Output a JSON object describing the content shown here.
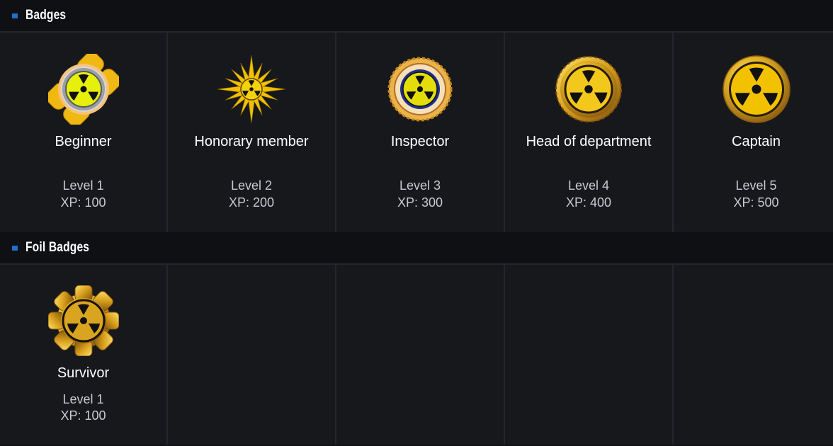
{
  "sections": {
    "badges": {
      "title": "Badges",
      "items": [
        {
          "name": "Beginner",
          "level": "Level 1",
          "xp": "XP: 100",
          "icon": "radiation-badge-cross-icon"
        },
        {
          "name": "Honorary member",
          "level": "Level 2",
          "xp": "XP: 200",
          "icon": "radiation-badge-star-icon"
        },
        {
          "name": "Inspector",
          "level": "Level 3",
          "xp": "XP: 300",
          "icon": "radiation-badge-seal-icon"
        },
        {
          "name": "Head of department",
          "level": "Level 4",
          "xp": "XP: 400",
          "icon": "radiation-badge-sun-icon"
        },
        {
          "name": "Captain",
          "level": "Level 5",
          "xp": "XP: 500",
          "icon": "radiation-badge-coin-icon"
        }
      ]
    },
    "foil": {
      "title": "Foil Badges",
      "items": [
        {
          "name": "Survivor",
          "level": "Level 1",
          "xp": "XP: 100",
          "icon": "radiation-badge-gear-icon"
        }
      ]
    }
  },
  "colors": {
    "accent": "#1f6fd0",
    "background": "#17181c",
    "gold": "#f2c200"
  }
}
